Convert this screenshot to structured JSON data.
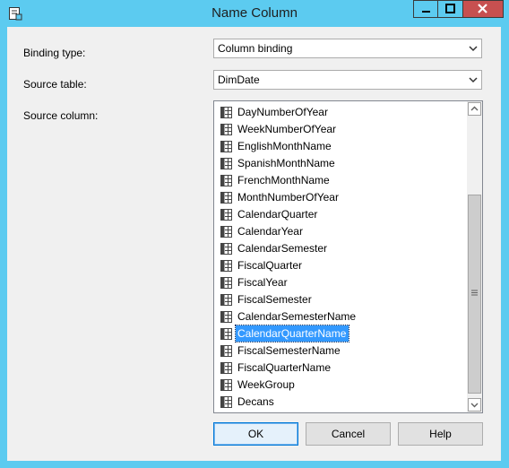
{
  "window": {
    "title": "Name Column",
    "accent_color": "#5ccbf0",
    "close_color": "#c75050",
    "system_icon": "dialog-app-icon"
  },
  "form": {
    "binding_type_label": "Binding type:",
    "binding_type_value": "Column binding",
    "source_table_label": "Source table:",
    "source_table_value": "DimDate",
    "source_column_label": "Source column:"
  },
  "source_columns": {
    "items": [
      "DayNumberOfYear",
      "WeekNumberOfYear",
      "EnglishMonthName",
      "SpanishMonthName",
      "FrenchMonthName",
      "MonthNumberOfYear",
      "CalendarQuarter",
      "CalendarYear",
      "CalendarSemester",
      "FiscalQuarter",
      "FiscalYear",
      "FiscalSemester",
      "CalendarSemesterName",
      "CalendarQuarterName",
      "FiscalSemesterName",
      "FiscalQuarterName",
      "WeekGroup",
      "Decans"
    ],
    "selected": "CalendarQuarterName",
    "item_icon": "column-icon",
    "selection_color": "#3399ff"
  },
  "buttons": {
    "ok": "OK",
    "cancel": "Cancel",
    "help": "Help"
  }
}
